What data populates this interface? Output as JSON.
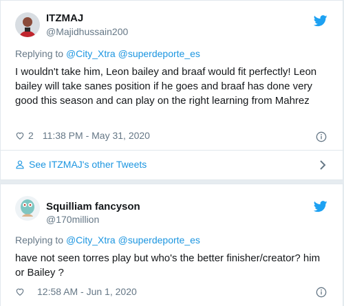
{
  "tweets": [
    {
      "name": "ITZMAJ",
      "handle": "@Majidhussain200",
      "reply_prefix": "Replying to ",
      "reply_mentions": "@City_Xtra @superdeporte_es",
      "text": "I wouldn't take him, Leon bailey and braaf would fit perfectly! Leon bailey will take sanes position if he goes and braaf has done very good this season and can play on the right learning from Mahrez",
      "likes": "2",
      "timestamp": "11:38 PM - May 31, 2020",
      "see_more": "See ITZMAJ's other Tweets"
    },
    {
      "name": "Squilliam fancyson",
      "handle": "@170million",
      "reply_prefix": "Replying to ",
      "reply_mentions": "@City_Xtra @superdeporte_es",
      "text": "have not seen torres play but who's the better finisher/creator? him or Bailey ?",
      "likes": "",
      "timestamp": "12:58 AM - Jun 1, 2020"
    }
  ],
  "icons": {
    "bird": "twitter-bird-icon",
    "heart": "heart-icon",
    "info": "info-icon",
    "person": "person-icon",
    "chevron": "chevron-right-icon"
  },
  "colors": {
    "link": "#1b95e0",
    "secondary": "#657786",
    "text": "#14171a",
    "border": "#e1e8ed",
    "background": "#e6ecf0"
  }
}
